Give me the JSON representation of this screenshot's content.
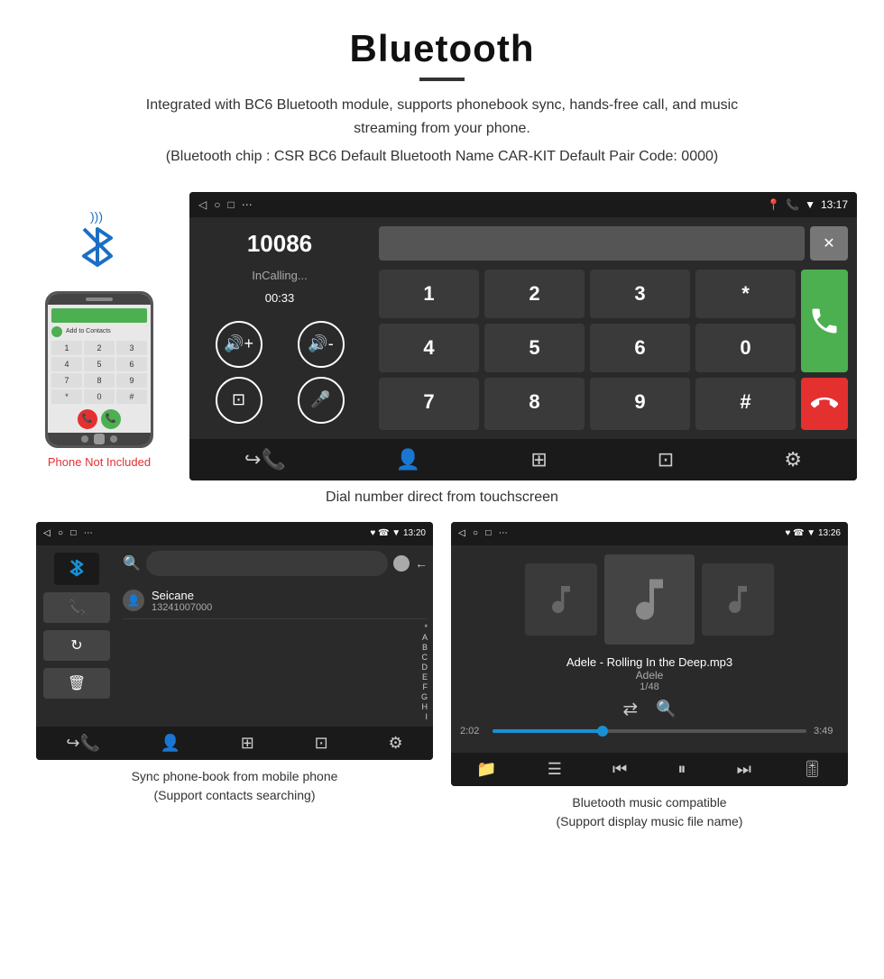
{
  "header": {
    "title": "Bluetooth",
    "description": "Integrated with BC6 Bluetooth module, supports phonebook sync, hands-free call, and music streaming from your phone.",
    "specs": "(Bluetooth chip : CSR BC6    Default Bluetooth Name CAR-KIT    Default Pair Code: 0000)"
  },
  "phone_label": "Phone Not Included",
  "dial_screen": {
    "status_bar": {
      "nav_back": "◁",
      "nav_home": "○",
      "nav_square": "□",
      "nav_dots": "⋯",
      "time": "13:17",
      "location_icon": "📍",
      "phone_icon": "📞",
      "wifi_icon": "▼"
    },
    "number": "10086",
    "status": "InCalling...",
    "timer": "00:33",
    "keys": [
      "1",
      "2",
      "3",
      "*",
      "4",
      "5",
      "6",
      "0",
      "7",
      "8",
      "9",
      "#"
    ],
    "bottom_nav": [
      "↪☎",
      "👤",
      "⊞",
      "⊡",
      "⚙"
    ]
  },
  "caption_dial": "Dial number direct from touchscreen",
  "phonebook_screen": {
    "status_bar": {
      "nav": "◁  ○  □  ⋯",
      "right": "♥ ☎ ▼ 13:20"
    },
    "contact_name": "Seicane",
    "contact_phone": "13241007000",
    "alpha_list": [
      "*",
      "A",
      "B",
      "C",
      "D",
      "E",
      "F",
      "G",
      "H",
      "I"
    ]
  },
  "caption_phonebook_1": "Sync phone-book from mobile phone",
  "caption_phonebook_2": "(Support contacts searching)",
  "music_screen": {
    "status_bar": {
      "nav": "◁  ○  □  ⋯",
      "right": "♥ ☎ ▼ 13:26"
    },
    "song_title": "Adele - Rolling In the Deep.mp3",
    "artist": "Adele",
    "counter": "1/48",
    "time_current": "2:02",
    "time_total": "3:49",
    "progress_percent": 35
  },
  "caption_music_1": "Bluetooth music compatible",
  "caption_music_2": "(Support display music file name)"
}
